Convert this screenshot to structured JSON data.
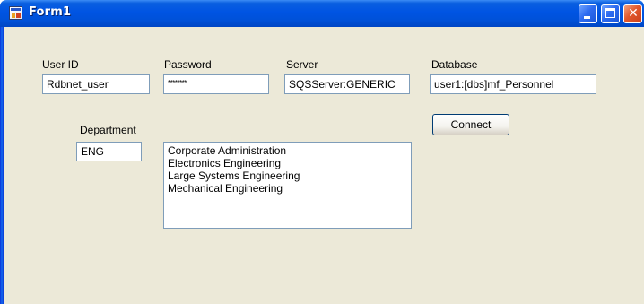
{
  "window": {
    "title": "Form1",
    "titlebar_color": "#0054e3",
    "client_color": "#ece9d8"
  },
  "titlebar_buttons": {
    "minimize_icon": "minimize-icon",
    "maximize_icon": "maximize-icon",
    "close_icon": "close-icon"
  },
  "fields": {
    "user_id": {
      "label": "User ID",
      "value": "Rdbnet_user"
    },
    "password": {
      "label": "Password",
      "value": "********"
    },
    "server": {
      "label": "Server",
      "value": "SQSServer:GENERIC"
    },
    "database": {
      "label": "Database",
      "value": "user1:[dbs]mf_Personnel"
    },
    "department": {
      "label": "Department",
      "value": "ENG"
    }
  },
  "connect_button": {
    "label": "Connect"
  },
  "department_list": [
    "Corporate Administration",
    "Electronics Engineering",
    "Large Systems Engineering",
    "Mechanical Engineering"
  ]
}
